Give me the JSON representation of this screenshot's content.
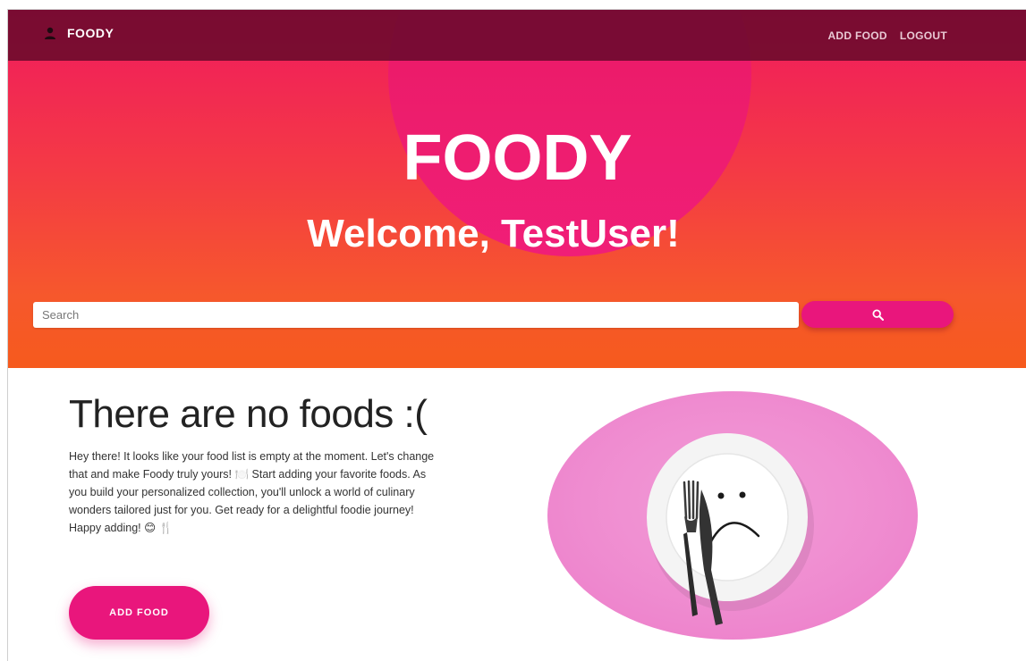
{
  "navbar": {
    "brand": "FOODY",
    "links": {
      "add_food": "ADD FOOD",
      "logout": "LOGOUT"
    }
  },
  "hero": {
    "title": "FOODY",
    "subtitle": "Welcome, TestUser!"
  },
  "search": {
    "placeholder": "Search",
    "value": "",
    "button_icon": "search-icon"
  },
  "empty_state": {
    "title": "There are no foods :(",
    "message": "Hey there! It looks like your food list is empty at the moment. Let's change that and make Foody truly yours! 🍽️ Start adding your favorite foods. As you build your personalized collection, you'll unlock a world of culinary wonders tailored just for you. Get ready for a delightful foodie journey! Happy adding! 😊 🍴",
    "button_label": "ADD FOOD",
    "image": "sad-plate-illustration"
  },
  "colors": {
    "accent": "#e9167c",
    "navbar": "#7a0a33",
    "hero_top": "#f01a5e",
    "hero_bottom": "#f65a1d",
    "plate_background": "#f08ad0"
  }
}
